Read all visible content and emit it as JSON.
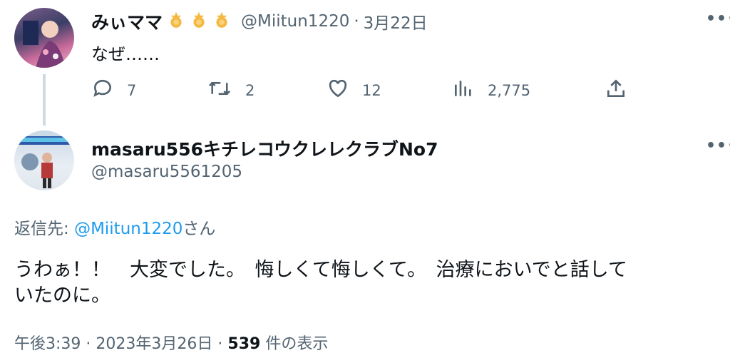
{
  "tweet1": {
    "display_name": "みぃママ",
    "badges": [
      "star-icon",
      "star-icon",
      "star-icon"
    ],
    "handle": "@Miitun1220",
    "separator": "·",
    "date": "3月22日",
    "text": "なぜ……",
    "stats": {
      "replies": "7",
      "retweets": "2",
      "likes": "12",
      "views": "2,775"
    }
  },
  "tweet2": {
    "display_name": "masaru556キチレコウクレレクラブNo7",
    "handle": "@masaru5561205",
    "reply_prefix": "返信先:",
    "reply_to": "@Miitun1220",
    "reply_suffix": "さん",
    "text_line1": "うわぁ！！　大変でした。　悔しくて悔しくて。　治療においでと話して",
    "text_line2": "いたのに。",
    "time": "午後3:39",
    "sep1": "·",
    "date": "2023年3月26日",
    "sep2": "·",
    "views_count": "539",
    "views_label": "件の表示"
  },
  "colors": {
    "accent": "#1d9bf0",
    "star": "#f4b942",
    "muted": "#536471",
    "thread_line": "#cfd9de"
  }
}
